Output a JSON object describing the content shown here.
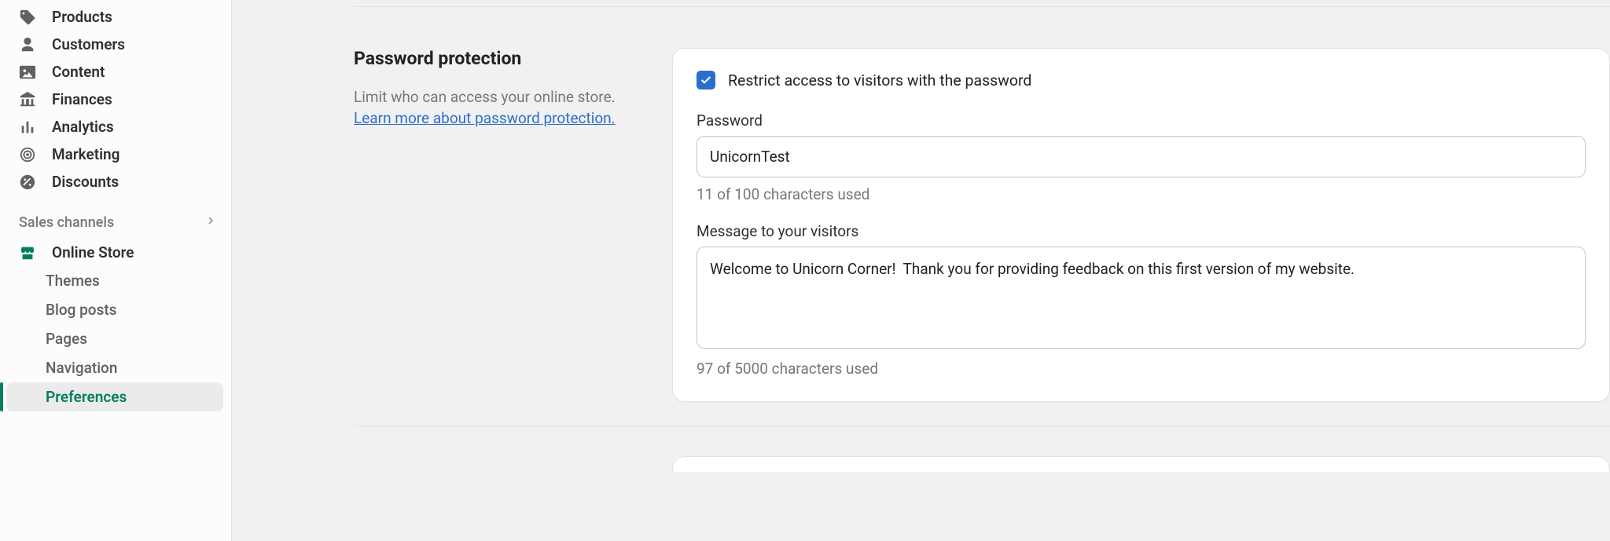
{
  "sidebar": {
    "nav": [
      {
        "label": "Products"
      },
      {
        "label": "Customers"
      },
      {
        "label": "Content"
      },
      {
        "label": "Finances"
      },
      {
        "label": "Analytics"
      },
      {
        "label": "Marketing"
      },
      {
        "label": "Discounts"
      }
    ],
    "section_header": "Sales channels",
    "online_store": "Online Store",
    "sub": [
      {
        "label": "Themes"
      },
      {
        "label": "Blog posts"
      },
      {
        "label": "Pages"
      },
      {
        "label": "Navigation"
      },
      {
        "label": "Preferences"
      }
    ]
  },
  "section": {
    "title": "Password protection",
    "description": "Limit who can access your online store.",
    "link": "Learn more about password protection."
  },
  "card": {
    "checkbox_label": "Restrict access to visitors with the password",
    "password_label": "Password",
    "password_value": "UnicornTest",
    "password_helper": "11 of 100 characters used",
    "message_label": "Message to your visitors",
    "message_value": "Welcome to Unicorn Corner!  Thank you for providing feedback on this first version of my website.",
    "message_helper": "97 of 5000 characters used"
  }
}
